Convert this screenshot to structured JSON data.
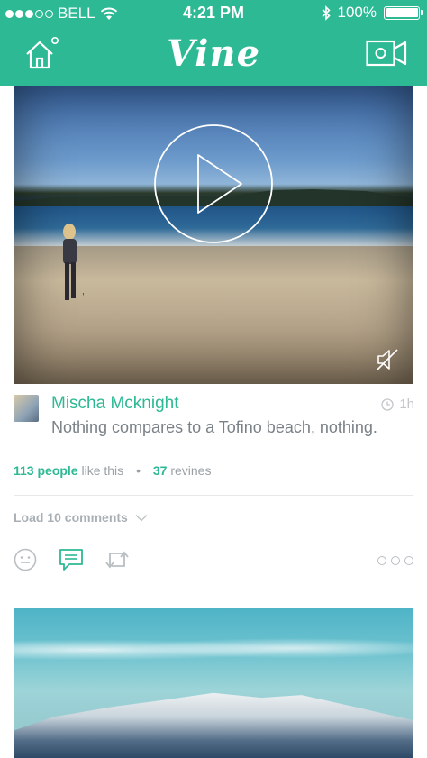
{
  "status_bar": {
    "carrier": "BELL",
    "time": "4:21 PM",
    "battery": "100%",
    "battery_level": 1.0
  },
  "nav": {
    "logo": "Vine",
    "home_icon": "home-icon",
    "camera_icon": "video-camera-icon"
  },
  "colors": {
    "brand": "#2db994",
    "muted_text": "#7a8187",
    "light_text": "#a9b0b5"
  },
  "post": {
    "username": "Mischa Mcknight",
    "time": "1h",
    "caption": "Nothing compares to a Tofino beach, nothing.",
    "likes_count": "113 people",
    "likes_suffix": "like this",
    "separator": "•",
    "revines_count": "37",
    "revines_suffix": "revines",
    "load_comments": "Load 10 comments"
  }
}
